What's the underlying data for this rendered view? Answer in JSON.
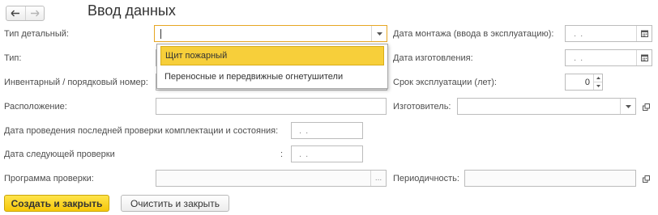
{
  "header": {
    "title": "Ввод данных",
    "back_icon": "arrow-left-icon",
    "forward_icon": "arrow-right-icon"
  },
  "left_form": {
    "type_detailed_label": "Тип детальный:",
    "type_label": "Тип:",
    "inventory_label": "Инвентарный / порядковый номер:",
    "location_label": "Расположение:",
    "last_check_label": "Дата проведения последней проверки комплектации и состояния:",
    "next_check_label": "Дата следующей проверки",
    "next_check_colon": ":",
    "program_label": "Программа проверки:",
    "date_placeholder": ". .",
    "ellipsis": "..."
  },
  "right_form": {
    "install_date_label": "Дата монтажа (ввода в эксплуатацию):",
    "manufacture_date_label": "Дата изготовления:",
    "service_life_label": "Срок эксплуатации (лет):",
    "service_life_value": "0",
    "manufacturer_label": "Изготовитель:",
    "periodicity_label": "Периодичность:",
    "date_placeholder": ". ."
  },
  "dropdown": {
    "items": [
      {
        "label": "Щит пожарный",
        "selected": true
      },
      {
        "label": "Переносные и передвижные огнетушители",
        "selected": false
      }
    ]
  },
  "footer": {
    "create_close_label": "Создать и закрыть",
    "clear_close_label": "Очистить и закрыть"
  },
  "colors": {
    "accent_yellow": "#f7cf3a",
    "focus_border": "#e6a623",
    "field_border": "#bcbcbc"
  }
}
